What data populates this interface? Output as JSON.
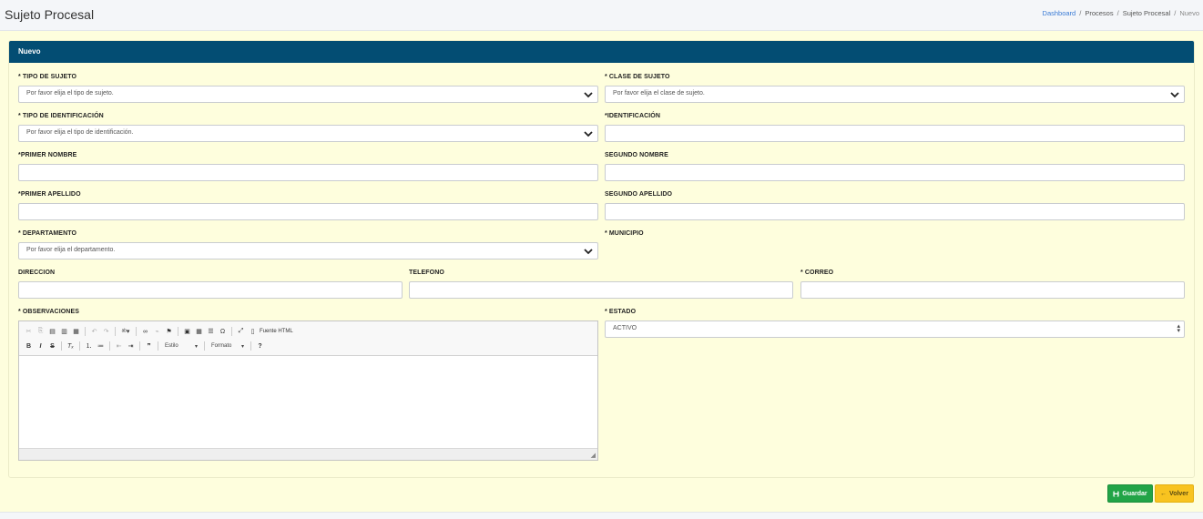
{
  "header": {
    "title": "Sujeto Procesal",
    "breadcrumb": [
      "Dashboard",
      "Procesos",
      "Sujeto Procesal",
      "Nuevo"
    ]
  },
  "card": {
    "title": "Nuevo"
  },
  "form": {
    "tipo_sujeto": {
      "label": "* TIPO DE SUJETO",
      "placeholder": "Por favor elija el tipo de sujeto."
    },
    "clase_sujeto": {
      "label": "* CLASE DE SUJETO",
      "placeholder": "Por favor elija el clase de sujeto."
    },
    "tipo_identificacion": {
      "label": "* TIPO DE IDENTIFICACIÓN",
      "placeholder": "Por favor elija el tipo de identificación."
    },
    "identificacion": {
      "label": "*IDENTIFICACIÓN",
      "value": ""
    },
    "primer_nombre": {
      "label": "*PRIMER NOMBRE",
      "value": ""
    },
    "segundo_nombre": {
      "label": "SEGUNDO NOMBRE",
      "value": ""
    },
    "primer_apellido": {
      "label": "*PRIMER APELLIDO",
      "value": ""
    },
    "segundo_apellido": {
      "label": "SEGUNDO APELLIDO",
      "value": ""
    },
    "departamento": {
      "label": "* DEPARTAMENTO",
      "placeholder": "Por favor elija el departamento."
    },
    "municipio": {
      "label": "* MUNICIPIO"
    },
    "direccion": {
      "label": "DIRECCION",
      "value": ""
    },
    "telefono": {
      "label": "TELEFONO",
      "value": ""
    },
    "correo": {
      "label": "* CORREO",
      "value": ""
    },
    "observaciones": {
      "label": "* OBSERVACIONES"
    },
    "estado": {
      "label": "* ESTADO",
      "value": "ACTIVO"
    }
  },
  "editor": {
    "source_label": "Fuente HTML",
    "style_label": "Estilo",
    "format_label": "Formato",
    "bold": "B",
    "italic": "I",
    "strike": "S",
    "help": "?",
    "quote": "❞",
    "omega": "Ω"
  },
  "buttons": {
    "save": "Guardar",
    "back": "Volver"
  },
  "colors": {
    "card_header": "#034d73",
    "background": "#fefedd",
    "save": "#22a447",
    "back": "#f8c320"
  }
}
